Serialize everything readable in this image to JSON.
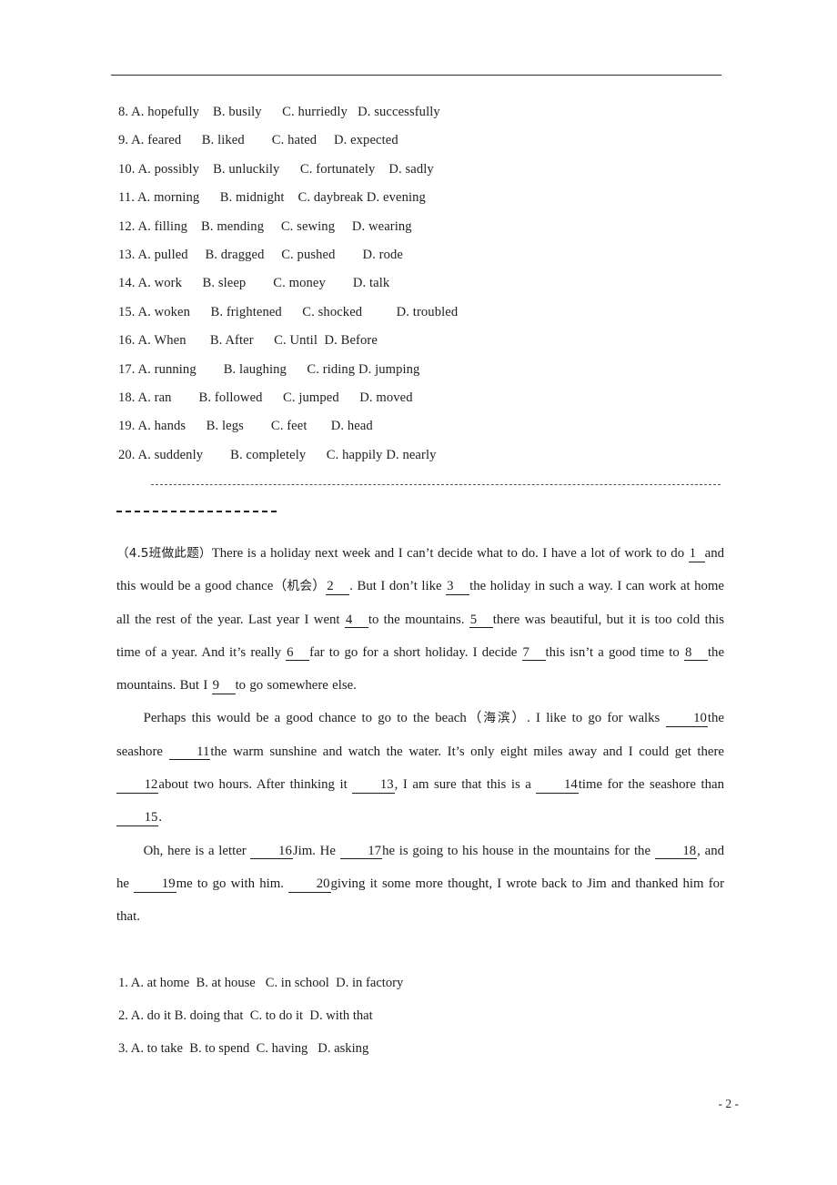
{
  "document": {
    "page_number_label": "- 2 -"
  },
  "options_top": [
    "8. A. hopefully    B. busily      C. hurriedly   D. successfully",
    "9. A. feared      B. liked        C. hated     D. expected",
    "10. A. possibly    B. unluckily      C. fortunately    D. sadly",
    "11. A. morning      B. midnight    C. daybreak D. evening",
    "12. A. filling    B. mending     C. sewing     D. wearing",
    "13. A. pulled     B. dragged     C. pushed        D. rode",
    "14. A. work      B. sleep        C. money        D. talk",
    "15. A. woken      B. frightened      C. shocked          D. troubled",
    "16. A. When       B. After      C. Until  D. Before",
    "17. A. running        B. laughing      C. riding D. jumping",
    "18. A. ran        B. followed      C. jumped      D. moved",
    "19. A. hands      B. legs        C. feet       D. head",
    "20. A. suddenly        B. completely      C. happily D. nearly"
  ],
  "passage": {
    "paragraph1": {
      "prefix": "（4.5班做此题）",
      "s1": "There is a holiday next week and I can’t decide what to do. I have a lot of work to do ",
      "b1": "1",
      "s2": "and this would be a good chance（",
      "cn1": "机会",
      "s3": "）",
      "b2": "2",
      "s4": ". But I don’t like ",
      "b3": "3",
      "s5": "the holiday in such a way. I can work at home all the rest of the year. Last year I went ",
      "b4": "4",
      "s6": "to the mountains. ",
      "b5": "5",
      "s7": "there was beautiful, but it is too cold this time of a year. And it’s really ",
      "b6": "6",
      "s8": "far to go for a short holiday. I decide ",
      "b7": "7",
      "s9": "this isn’t a good time to ",
      "b8": "8",
      "s10": "the mountains. But I ",
      "b9": "9",
      "s11": "to go somewhere else."
    },
    "paragraph2": {
      "s1": "Perhaps this would be a good chance to go to the beach（",
      "cn1": "海滨",
      "s2": "）. I like to go for walks ",
      "b10": "10",
      "s3": "the seashore ",
      "b11": "11",
      "s4": "the warm sunshine and watch the water. It’s only eight miles away and I could get there ",
      "b12": "12",
      "s5": "about two hours. After thinking it ",
      "b13": "13",
      "s6": ", I am sure that this is a ",
      "b14": "14",
      "s7": "time for the seashore than ",
      "b15": "15",
      "s8": "."
    },
    "paragraph3": {
      "s1": "Oh, here is a letter ",
      "b16": "16",
      "s2": "Jim. He ",
      "b17": "17",
      "s3": "he is going to his house in the mountains for the ",
      "b18": "18",
      "s4": ", and he ",
      "b19": "19",
      "s5": "me to go with him. ",
      "b20": "20",
      "s6": "giving it some more thought, I wrote back to Jim and thanked him for that."
    }
  },
  "options_bottom": [
    "1. A. at home  B. at house   C. in school  D. in factory",
    "2. A. do it B. doing that  C. to do it  D. with that",
    "3. A. to take  B. to spend  C. having   D. asking"
  ]
}
